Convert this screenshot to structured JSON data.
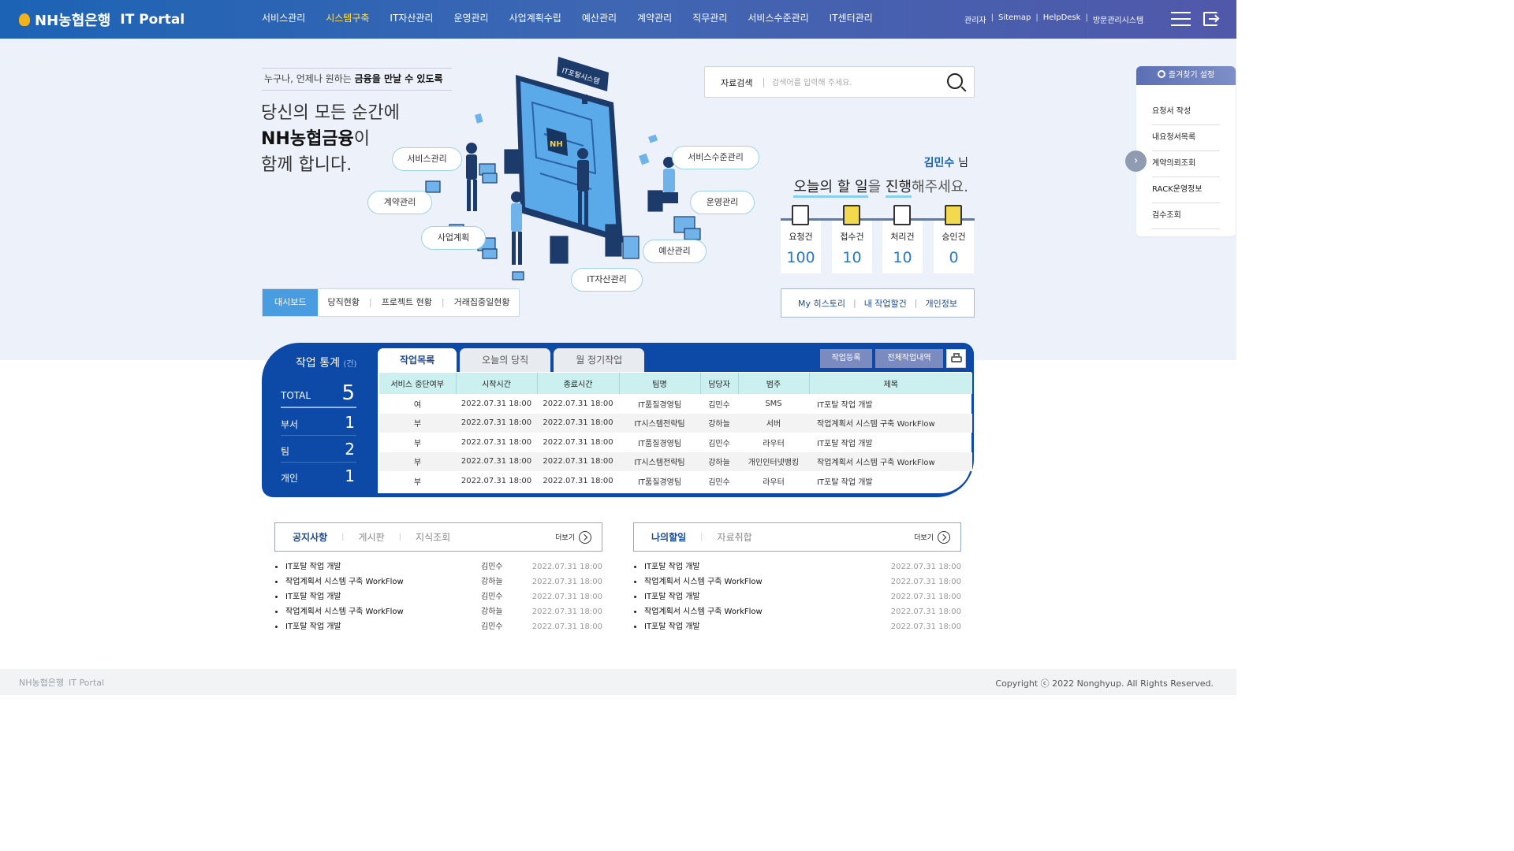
{
  "header": {
    "logo_text": "NH농협은행",
    "portal_text": "IT Portal",
    "nav": [
      "서비스관리",
      "시스템구축",
      "IT자산관리",
      "운영관리",
      "사업계획수립",
      "예산관리",
      "계약관리",
      "직무관리",
      "서비스수준관리",
      "IT센터관리"
    ],
    "active_nav": "시스템구축",
    "util": [
      "관리자",
      "Sitemap",
      "HelpDesk",
      "방문관리시스템"
    ],
    "separator": "|"
  },
  "hero": {
    "subtitle_plain": "누구나, 언제나 원하는",
    "subtitle_bold": "금융을 만날 수 있도록",
    "title_line1": "당신의 모든 순간에",
    "title_line2_bold": "NH농협금융",
    "title_line2_rest": "이",
    "title_line3": "함께 합니다.",
    "illustration_sign": "IT포탈시스템",
    "illustration_logo": "NH",
    "bubbles": [
      "서비스관리",
      "계약관리",
      "사업계획",
      "IT자산관리",
      "예산관리",
      "운영관리",
      "서비스수준관리"
    ]
  },
  "dashboard_tabs": [
    "대시보드",
    "당직현황",
    "프로젝트 현황",
    "거래집중일현황"
  ],
  "search": {
    "label": "자료검색",
    "placeholder": "검색어를 입력해 주세요."
  },
  "user": {
    "name": "김민수",
    "suffix": "님",
    "todo_1": "오늘의 할 일",
    "todo_2": "을 ",
    "todo_3": "진행",
    "todo_4": "해주세요."
  },
  "summary": [
    {
      "label": "요청건",
      "value": "100"
    },
    {
      "label": "접수건",
      "value": "10"
    },
    {
      "label": "처리건",
      "value": "10"
    },
    {
      "label": "승인건",
      "value": "0"
    }
  ],
  "quick_links": [
    "My 히스토리",
    "내 작업할건",
    "개인정보"
  ],
  "favorites": {
    "title": "즐겨찾기 설정",
    "items": [
      "요청서 작성",
      "내요청서목록",
      "계약의뢰조회",
      "RACK운영정보",
      "검수조회"
    ],
    "arrow": "›"
  },
  "work_stats": {
    "title": "작업 통계",
    "unit": "(건)",
    "rows": [
      {
        "label": "TOTAL",
        "value": "5"
      },
      {
        "label": "부서",
        "value": "1"
      },
      {
        "label": "팀",
        "value": "2"
      },
      {
        "label": "개인",
        "value": "1"
      }
    ]
  },
  "work_panel": {
    "tabs": [
      "작업목록",
      "오늘의 당직",
      "월 정기작업"
    ],
    "buttons": [
      "작업등록",
      "전체작업내역"
    ],
    "columns": [
      "서비스 중단여부",
      "시작시간",
      "종료시간",
      "팀명",
      "담당자",
      "범주",
      "제목"
    ],
    "rows": [
      [
        "여",
        "2022.07.31 18:00",
        "2022.07.31 18:00",
        "IT품질경영팀",
        "김민수",
        "SMS",
        "IT포탈 작업 개발"
      ],
      [
        "부",
        "2022.07.31 18:00",
        "2022.07.31 18:00",
        "IT시스템전략팀",
        "강하늘",
        "서버",
        "작업계획서 시스템 구축 WorkFlow"
      ],
      [
        "부",
        "2022.07.31 18:00",
        "2022.07.31 18:00",
        "IT품질경영팀",
        "김민수",
        "라우터",
        "IT포탈 작업 개발"
      ],
      [
        "부",
        "2022.07.31 18:00",
        "2022.07.31 18:00",
        "IT시스템전략팀",
        "강하늘",
        "개인인터넷뱅킹",
        "작업계획서 시스템 구축 WorkFlow"
      ],
      [
        "부",
        "2022.07.31 18:00",
        "2022.07.31 18:00",
        "IT품질경영팀",
        "김민수",
        "라우터",
        "IT포탈 작업 개발"
      ]
    ]
  },
  "notice_board": {
    "tabs": [
      "공지사항",
      "게시판",
      "지식조회"
    ],
    "more": "더보기",
    "items": [
      {
        "title": "IT포탈 작업 개발",
        "author": "김민수",
        "date": "2022.07.31 18:00"
      },
      {
        "title": "작업계획서 시스템 구축 WorkFlow",
        "author": "강하늘",
        "date": "2022.07.31 18:00"
      },
      {
        "title": "IT포탈 작업 개발",
        "author": "김민수",
        "date": "2022.07.31 18:00"
      },
      {
        "title": "작업계획서 시스템 구축 WorkFlow",
        "author": "강하늘",
        "date": "2022.07.31 18:00"
      },
      {
        "title": "IT포탈 작업 개발",
        "author": "김민수",
        "date": "2022.07.31 18:00"
      }
    ]
  },
  "todo_board": {
    "tabs": [
      "나의할일",
      "자료취합"
    ],
    "more": "더보기",
    "items": [
      {
        "title": "IT포탈 작업 개발",
        "date": "2022.07.31 18:00"
      },
      {
        "title": "작업계획서 시스템 구축 WorkFlow",
        "date": "2022.07.31 18:00"
      },
      {
        "title": "IT포탈 작업 개발",
        "date": "2022.07.31 18:00"
      },
      {
        "title": "작업계획서 시스템 구축 WorkFlow",
        "date": "2022.07.31 18:00"
      },
      {
        "title": "IT포탈 작업 개발",
        "date": "2022.07.31 18:00"
      }
    ]
  },
  "footer": {
    "logo": "NH농협은행",
    "portal": "IT Portal",
    "copyright": "Copyright ⓒ 2022 Nonghyup. All Rights Reserved."
  },
  "colors": {
    "header_start": "#1c63b5",
    "header_end": "#5158aa",
    "active_nav": "#ffe25a",
    "panel_blue": "#0d49a7",
    "table_header": "#ccf0f0",
    "accent_blue": "#2a77c5"
  }
}
